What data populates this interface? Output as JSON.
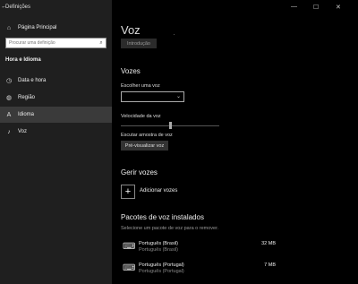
{
  "window": {
    "title": "Definições",
    "minimize_icon": "—",
    "maximize_icon": "☐",
    "close_icon": "✕"
  },
  "sidebar": {
    "home_label": "Página Principal",
    "search_placeholder": "Procurar uma definição",
    "section_title": "Hora e Idioma",
    "items": [
      {
        "label": "Data e hora",
        "icon": "calendar-clock-icon"
      },
      {
        "label": "Região",
        "icon": "globe-icon"
      },
      {
        "label": "Idioma",
        "icon": "language-icon"
      },
      {
        "label": "Voz",
        "icon": "microphone-icon"
      }
    ],
    "active_item": "Idioma"
  },
  "main": {
    "page_title": "Voz",
    "intro_button": "Introdução",
    "voices_heading": "Vozes",
    "choose_voice_label": "Escolher uma voz",
    "choose_voice_value": "",
    "speed_label": "Velocidade da voz",
    "speed_value": 0.5,
    "sample_label": "Escutar amostra de voz",
    "preview_button": "Pré-visualizar voz",
    "manage_heading": "Gerir vozes",
    "add_voices_label": "Adicionar vozes",
    "installed_heading": "Pacotes de voz instalados",
    "installed_hint": "Selecione um pacote de voz para o remover.",
    "packs": [
      {
        "name": "Português (Brasil)",
        "sub": "Português (Brasil)",
        "size": "32 MB"
      },
      {
        "name": "Português (Portugal)",
        "sub": "Português (Portugal)",
        "size": "7 MB"
      }
    ]
  }
}
